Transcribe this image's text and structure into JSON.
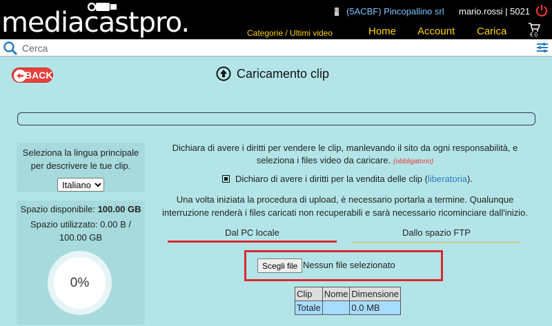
{
  "header": {
    "logo_text": "mediacastpro.",
    "company": "(5ACBF) Pincopallino srl",
    "user": "mario.rossi | 5021",
    "categories_link": "Categorie / Ultimi video",
    "nav": [
      "Home",
      "Account",
      "Carica"
    ],
    "cart_amount": "€ 0"
  },
  "search": {
    "placeholder": "Cerca"
  },
  "page": {
    "back_label": "BACK",
    "title": "Caricamento clip"
  },
  "progress": {
    "value": 0
  },
  "language_panel": {
    "prompt": "Seleziona la lingua principale per descrivere le tue clip.",
    "selected": "Italiano"
  },
  "space_panel": {
    "available_label": "Spazio disponibile:",
    "available_value": "100.00 GB",
    "used_text": "Spazio utilizzato: 0.00 B / 100.00 GB",
    "percent": "0%"
  },
  "declaration": {
    "text": "Dichiara di avere i diritti per vendere le clip, manlevando il sito da ogni responsabilità, e seleziona i files video da caricare.",
    "required": "(obbligatorio)",
    "checkbox_label": "Dichiaro di avere i diritti per la vendita delle clip (",
    "checkbox_link": "liberatoria",
    "checkbox_end": ").",
    "checked": true
  },
  "warning": "Una volta iniziata la procedura di upload, è necessario portarla a termine. Qualunque interruzione renderà i files caricati non recuperabili e sarà necessario ricominciare dall'inizio.",
  "tabs": [
    "Dal PC locale",
    "Dallo spazio FTP"
  ],
  "file_input": {
    "button": "Scegli file",
    "status": "Nessun file selezionato"
  },
  "clip_table": {
    "headers": [
      "Clip",
      "Nome",
      "Dimensione"
    ],
    "total_row": [
      "Totale",
      "",
      "0.0 MB"
    ]
  },
  "colors": {
    "accent_red": "#d9282e",
    "nav_yellow": "#ffd200",
    "background": "#b3e5e8"
  }
}
